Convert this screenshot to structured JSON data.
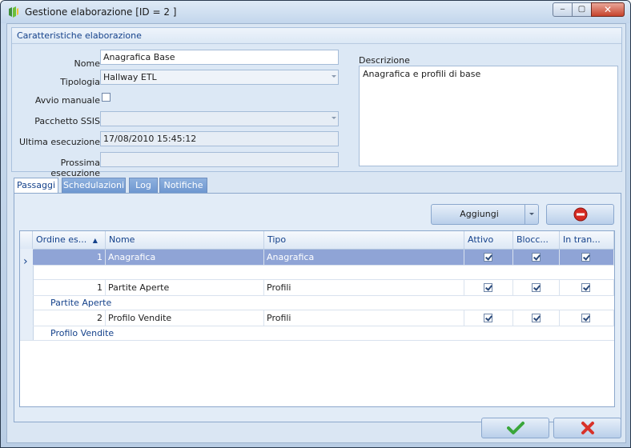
{
  "window": {
    "title": "Gestione elaborazione [ID = 2 ]",
    "controls": {
      "minimize": "‒",
      "maximize": "▢",
      "close": "✕"
    }
  },
  "group": {
    "header": "Caratteristiche elaborazione",
    "fields": {
      "nome_label": "Nome",
      "nome_value": "Anagrafica Base",
      "tipologia_label": "Tipologia",
      "tipologia_value": "Hallway ETL",
      "avvio_label": "Avvio manuale",
      "avvio_checked": false,
      "pacchetto_label": "Pacchetto SSIS",
      "pacchetto_value": "",
      "ultima_label": "Ultima esecuzione",
      "ultima_value": "17/08/2010 15:45:12",
      "prossima_label": "Prossima esecuzione",
      "prossima_value": ""
    },
    "descrizione_label": "Descrizione",
    "descrizione_value": "Anagrafica e profili di base"
  },
  "tabs": [
    "Passaggi",
    "Schedulazioni",
    "Log",
    "Notifiche"
  ],
  "toolbar": {
    "aggiungi_label": "Aggiungi",
    "remove_icon": "no-entry-icon"
  },
  "grid": {
    "columns": [
      "Ordine es...",
      "Nome",
      "Tipo",
      "Attivo",
      "Blocc...",
      "In tran..."
    ],
    "sort_indicator": "▲",
    "rows": [
      {
        "ordine": "1",
        "nome": "Anagrafica",
        "tipo": "Anagrafica",
        "attivo": true,
        "blocc": true,
        "intran": true,
        "group_label": ""
      },
      {
        "ordine": "1",
        "nome": "Partite Aperte",
        "tipo": "Profili",
        "attivo": true,
        "blocc": true,
        "intran": true,
        "group_label": "Partite Aperte"
      },
      {
        "ordine": "2",
        "nome": "Profilo Vendite",
        "tipo": "Profili",
        "attivo": true,
        "blocc": true,
        "intran": true,
        "group_label": "Profilo Vendite"
      }
    ],
    "current_row_marker": "›"
  },
  "footer": {
    "ok_icon": "check-icon",
    "cancel_icon": "x-icon"
  },
  "colors": {
    "selection": "#8fa4d6",
    "accent": "#15428b",
    "ok": "#3aa63a",
    "cancel": "#d8322a"
  }
}
